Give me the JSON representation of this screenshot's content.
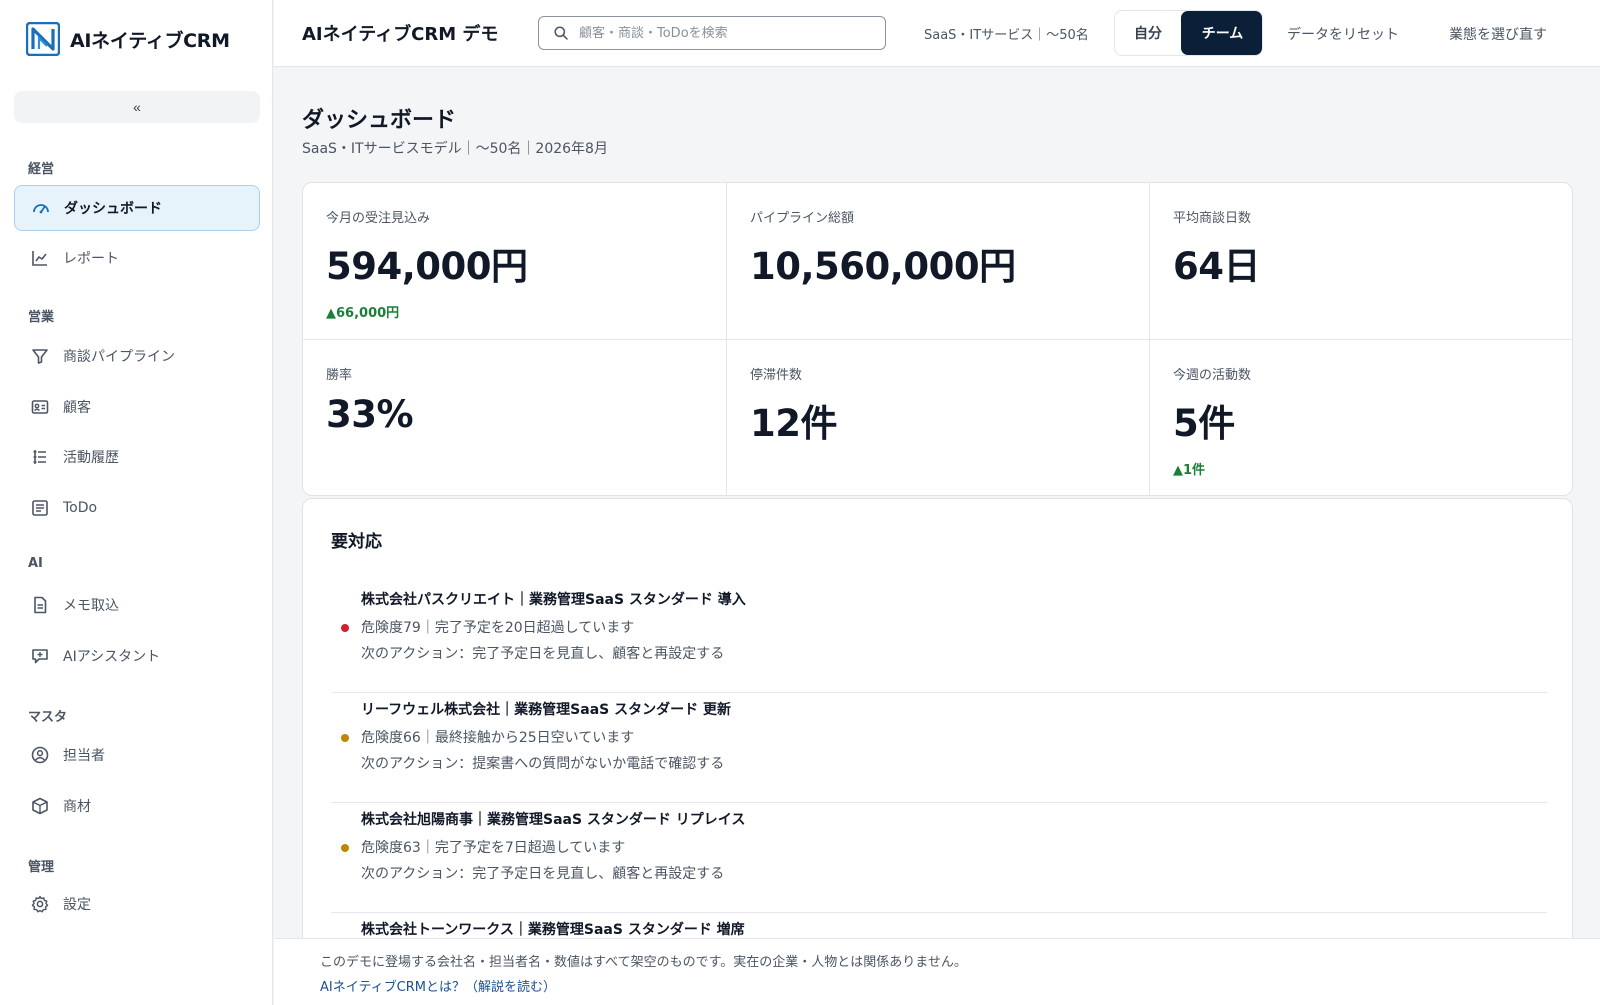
{
  "brand": {
    "name": "AIネイティブCRM"
  },
  "sidebar": {
    "collapse_label": "«",
    "sections": [
      {
        "title": "経営",
        "items": [
          {
            "label": "ダッシュボード",
            "icon": "gauge-icon",
            "active": true
          },
          {
            "label": "レポート",
            "icon": "line-chart-icon"
          }
        ]
      },
      {
        "title": "営業",
        "items": [
          {
            "label": "商談パイプライン",
            "icon": "filter-icon"
          },
          {
            "label": "顧客",
            "icon": "contact-card-icon"
          },
          {
            "label": "活動履歴",
            "icon": "timeline-list-icon"
          },
          {
            "label": "ToDo",
            "icon": "checklist-icon"
          }
        ]
      },
      {
        "title": "AI",
        "items": [
          {
            "label": "メモ取込",
            "icon": "document-icon"
          },
          {
            "label": "AIアシスタント",
            "icon": "chat-sparkle-icon"
          }
        ]
      },
      {
        "title": "マスタ",
        "items": [
          {
            "label": "担当者",
            "icon": "user-circle-icon"
          },
          {
            "label": "商材",
            "icon": "box-icon"
          }
        ]
      },
      {
        "title": "管理",
        "items": [
          {
            "label": "設定",
            "icon": "gear-icon"
          }
        ]
      }
    ]
  },
  "topbar": {
    "title": "AIネイティブCRM デモ",
    "search_placeholder": "顧客・商談・ToDoを検索",
    "business_type": "SaaS・ITサービス｜〜50名",
    "scope_self": "自分",
    "scope_team": "チーム",
    "reset_label": "データをリセット",
    "rechoose_label": "業態を選び直す"
  },
  "page": {
    "title": "ダッシュボード",
    "subtitle": "SaaS・ITサービスモデル｜〜50名｜2026年8月"
  },
  "kpis": [
    {
      "label": "今月の受注見込み",
      "value": "594,000円",
      "delta": "▲66,000円"
    },
    {
      "label": "パイプライン総額",
      "value": "10,560,000円",
      "delta": ""
    },
    {
      "label": "平均商談日数",
      "value": "64日",
      "delta": ""
    },
    {
      "label": "勝率",
      "value": "33%",
      "delta": ""
    },
    {
      "label": "停滞件数",
      "value": "12件",
      "delta": ""
    },
    {
      "label": "今週の活動数",
      "value": "5件",
      "delta": "▲1件"
    }
  ],
  "actions": {
    "title": "要対応",
    "items": [
      {
        "name": "株式会社パスクリエイト｜業務管理SaaS スタンダード 導入",
        "risk": "危険度79｜完了予定を20日超過しています",
        "next": "次のアクション：完了予定日を見直し、顧客と再設定する",
        "color": "#cf222e"
      },
      {
        "name": "リーフウェル株式会社｜業務管理SaaS スタンダード 更新",
        "risk": "危険度66｜最終接触から25日空いています",
        "next": "次のアクション：提案書への質問がないか電話で確認する",
        "color": "#bf8700"
      },
      {
        "name": "株式会社旭陽商事｜業務管理SaaS スタンダード リプレイス",
        "risk": "危険度63｜完了予定を7日超過しています",
        "next": "次のアクション：完了予定日を見直し、顧客と再設定する",
        "color": "#bf8700"
      },
      {
        "name": "株式会社トーンワークス｜業務管理SaaS スタンダード 増席",
        "risk": "",
        "next": "",
        "color": "#bf8700"
      }
    ]
  },
  "footer": {
    "note": "このデモに登場する会社名・担当者名・数値はすべて架空のものです。実在の企業・人物とは関係ありません。",
    "link": "AIネイティブCRMとは？（解説を読む）"
  },
  "colors": {
    "accent": "#0b1f38",
    "active_nav_bg": "#e6f3fb",
    "positive": "#1a7f37",
    "danger": "#cf222e",
    "warning": "#bf8700"
  }
}
